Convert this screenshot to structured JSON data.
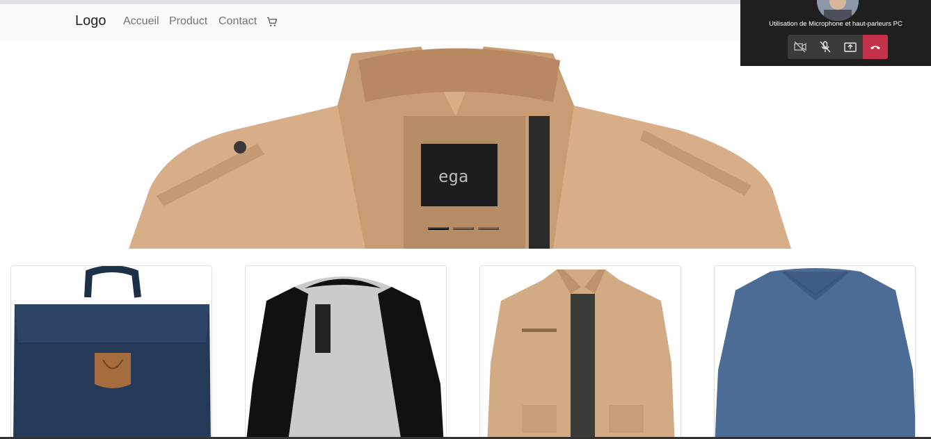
{
  "navbar": {
    "brand": "Logo",
    "links": [
      "Accueil",
      "Product",
      "Contact"
    ],
    "cart_icon": "cart-icon"
  },
  "carousel": {
    "slide": "khaki-jacket",
    "indicator_count": 3,
    "active_index": 0
  },
  "products": [
    {
      "image": "navy-backpack"
    },
    {
      "image": "black-grey-raglan-henley"
    },
    {
      "image": "khaki-jacket"
    },
    {
      "image": "blue-v-neck-sweater"
    }
  ],
  "call_widget": {
    "status": "Utilisation de Microphone et haut-parleurs PC",
    "buttons": [
      "camera-off-icon",
      "mic-off-icon",
      "share-screen-icon",
      "hang-up-icon"
    ],
    "hangup_color": "#c4314b"
  }
}
